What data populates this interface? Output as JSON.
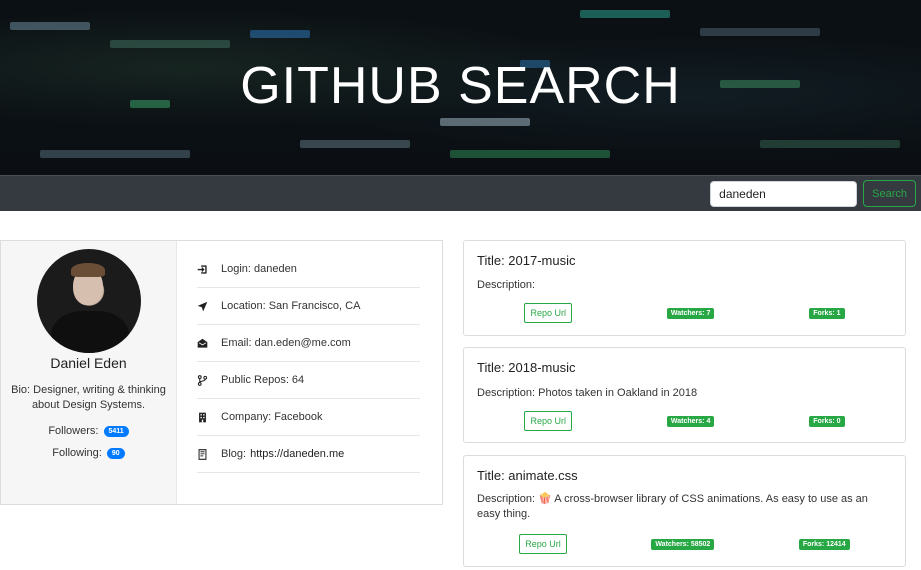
{
  "hero": {
    "title": "GITHUB SEARCH"
  },
  "navbar": {
    "search_value": "daneden",
    "search_button": "Search"
  },
  "profile": {
    "name": "Daniel Eden",
    "bio": "Bio: Designer, writing & thinking about Design Systems.",
    "followers_label": "Followers:",
    "followers": "5411",
    "following_label": "Following:",
    "following": "90",
    "info": [
      {
        "icon": "sign-in-icon",
        "text": "Login: daneden"
      },
      {
        "icon": "location-arrow-icon",
        "text": "Location: San Francisco, CA"
      },
      {
        "icon": "envelope-icon",
        "text": "Email: dan.eden@me.com"
      },
      {
        "icon": "code-branch-icon",
        "text": "Public Repos: 64"
      },
      {
        "icon": "building-icon",
        "text": "Company: Facebook"
      },
      {
        "icon": "blog-icon",
        "text": "Blog:",
        "link": "https://daneden.me"
      }
    ]
  },
  "repos": [
    {
      "title": "Title: 2017-music",
      "description": "Description:",
      "button": "Repo Url",
      "watchers": "Watchers: 7",
      "forks": "Forks: 1"
    },
    {
      "title": "Title: 2018-music",
      "description": "Description: Photos taken in Oakland in 2018",
      "button": "Repo Url",
      "watchers": "Watchers: 4",
      "forks": "Forks: 0"
    },
    {
      "title": "Title: animate.css",
      "description": "Description: 🍿 A cross-browser library of CSS animations. As easy to use as an easy thing.",
      "button": "Repo Url",
      "watchers": "Watchers: 58502",
      "forks": "Forks: 12414"
    }
  ],
  "colors": {
    "accent_green": "#28a745",
    "badge_blue": "#007bff",
    "navbar": "#343a40"
  }
}
